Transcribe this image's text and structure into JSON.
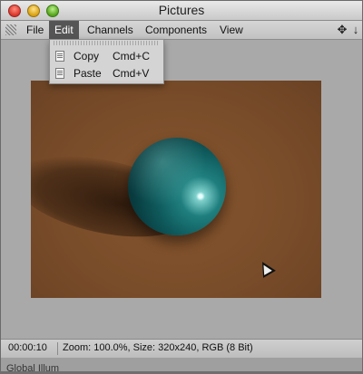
{
  "window": {
    "title": "Pictures"
  },
  "menubar": {
    "items": [
      {
        "label": "File"
      },
      {
        "label": "Edit"
      },
      {
        "label": "Channels"
      },
      {
        "label": "Components"
      },
      {
        "label": "View"
      }
    ],
    "active_item": "Edit"
  },
  "edit_menu": {
    "items": [
      {
        "label": "Copy",
        "shortcut": "Cmd+C",
        "icon": "document-icon"
      },
      {
        "label": "Paste",
        "shortcut": "Cmd+V",
        "icon": "document-icon"
      }
    ]
  },
  "icons": {
    "grip": "grip-icon",
    "move": "move-icon",
    "down": "down-arrow-icon"
  },
  "statusbar": {
    "time": "00:00:10",
    "info": "Zoom: 100.0%, Size: 320x240, RGB (8 Bit)"
  },
  "bottom_panel": {
    "label": "Global Illum"
  },
  "colors": {
    "menu_highlight": "#555555",
    "render_background": "#7a4d2a",
    "sphere": "#0f5a5c"
  }
}
